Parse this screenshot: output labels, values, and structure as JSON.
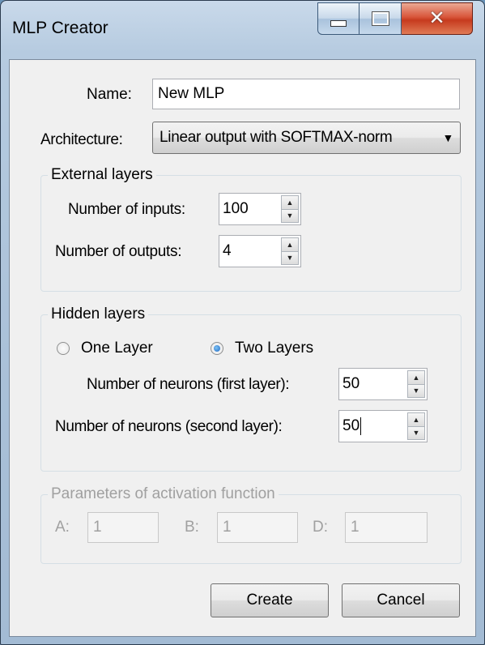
{
  "window": {
    "title": "MLP Creator"
  },
  "form": {
    "name_label": "Name:",
    "name_value": "New MLP",
    "architecture_label": "Architecture:",
    "architecture_value": "Linear output with  SOFTMAX-norm"
  },
  "external": {
    "title": "External layers",
    "inputs_label": "Number of inputs:",
    "inputs_value": "100",
    "outputs_label": "Number of outputs:",
    "outputs_value": "4"
  },
  "hidden": {
    "title": "Hidden layers",
    "one_layer_label": "One Layer",
    "two_layers_label": "Two Layers",
    "selected": "Two Layers",
    "first_label": "Number of neurons (first layer):",
    "first_value": "50",
    "second_label": "Number of neurons (second layer):",
    "second_value": "50"
  },
  "activation": {
    "title": "Parameters of activation function",
    "a_label": "A:",
    "a_value": "1",
    "b_label": "B:",
    "b_value": "1",
    "d_label": "D:",
    "d_value": "1"
  },
  "buttons": {
    "create": "Create",
    "cancel": "Cancel"
  }
}
